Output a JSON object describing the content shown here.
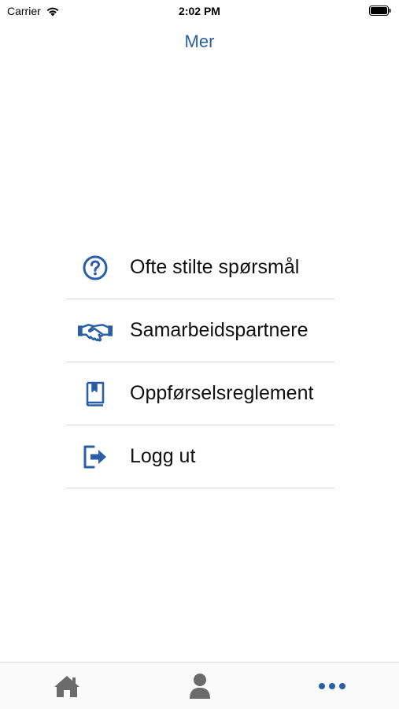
{
  "status_bar": {
    "carrier": "Carrier",
    "time": "2:02 PM"
  },
  "nav": {
    "title": "Mer"
  },
  "menu": {
    "items": [
      {
        "label": "Ofte stilte spørsmål",
        "icon": "question-circle-icon"
      },
      {
        "label": "Samarbeidspartnere",
        "icon": "handshake-icon"
      },
      {
        "label": "Oppførselsreglement",
        "icon": "book-icon"
      },
      {
        "label": "Logg ut",
        "icon": "logout-icon"
      }
    ]
  },
  "tab_bar": {
    "tabs": [
      {
        "icon": "home-icon",
        "active": false
      },
      {
        "icon": "user-icon",
        "active": false
      },
      {
        "icon": "more-icon",
        "active": true
      }
    ]
  },
  "colors": {
    "accent": "#2a5fa6",
    "tab_inactive": "#6b6b6b",
    "divider": "#d6d6d6"
  }
}
